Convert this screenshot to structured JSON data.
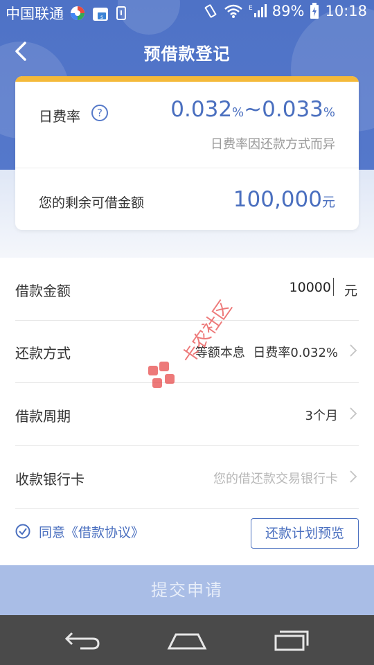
{
  "status_bar": {
    "carrier": "中国联通",
    "battery": "89%",
    "time": "10:18"
  },
  "header": {
    "title": "预借款登记"
  },
  "card": {
    "rate_label": "日费率",
    "rate_value_low": "0.032",
    "rate_value_sep": "~",
    "rate_value_high": "0.033",
    "rate_unit": "%",
    "rate_note": "日费率因还款方式而异",
    "limit_label": "您的剩余可借金额",
    "limit_value": "100,000",
    "limit_unit": "元"
  },
  "form": {
    "amount_label": "借款金额",
    "amount_value": "10000",
    "amount_unit": "元",
    "repay_label": "还款方式",
    "repay_value": "等额本息  日费率0.032%",
    "period_label": "借款周期",
    "period_value": "3个月",
    "bank_label": "收款银行卡",
    "bank_placeholder": "您的借还款交易银行卡",
    "agree_prefix": "同意",
    "agree_link": "《借款协议》",
    "preview_button": "还款计划预览"
  },
  "submit_button": "提交申请",
  "watermark_text": "卡农社区",
  "colors": {
    "primary": "#4e72c6",
    "accent": "#f4b93a",
    "submit_disabled": "#a9bde6",
    "navbar": "#4a4a4a"
  }
}
